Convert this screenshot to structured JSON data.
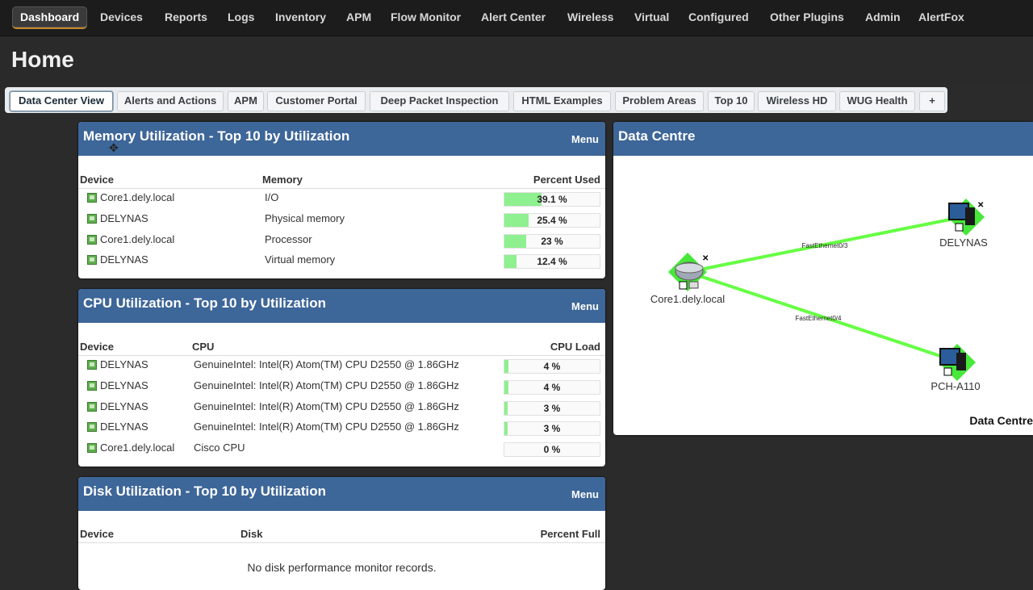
{
  "nav": [
    {
      "label": "Dashboard",
      "active": true
    },
    {
      "label": "Devices"
    },
    {
      "label": "Reports"
    },
    {
      "label": "Logs"
    },
    {
      "label": "Inventory"
    },
    {
      "label": "APM"
    },
    {
      "label": "Flow Monitor"
    },
    {
      "label": "Alert Center"
    },
    {
      "label": "Wireless"
    },
    {
      "label": "Virtual"
    },
    {
      "label": "Configured"
    },
    {
      "label": "Other Plugins"
    },
    {
      "label": "Admin"
    },
    {
      "label": "AlertFox"
    }
  ],
  "page": {
    "title": "Home"
  },
  "tabs": [
    {
      "label": "Data Center View",
      "active": true
    },
    {
      "label": "Alerts and Actions"
    },
    {
      "label": "APM"
    },
    {
      "label": "Customer Portal"
    },
    {
      "label": "Deep Packet Inspection"
    },
    {
      "label": "HTML Examples"
    },
    {
      "label": "Problem Areas"
    },
    {
      "label": "Top 10"
    },
    {
      "label": "Wireless HD"
    },
    {
      "label": "WUG Health"
    },
    {
      "label": "+"
    }
  ],
  "memory": {
    "title": "Memory Utilization - Top 10 by Utilization",
    "menu": "Menu",
    "columns": {
      "device": "Device",
      "metric": "Memory",
      "value": "Percent Used"
    },
    "rows": [
      {
        "device": "Core1.dely.local",
        "metric": "I/O",
        "pct": 39.1,
        "label": "39.1 %"
      },
      {
        "device": "DELYNAS",
        "metric": "Physical memory",
        "pct": 25.4,
        "label": "25.4 %"
      },
      {
        "device": "Core1.dely.local",
        "metric": "Processor",
        "pct": 23,
        "label": "23 %"
      },
      {
        "device": "DELYNAS",
        "metric": "Virtual memory",
        "pct": 12.4,
        "label": "12.4 %"
      }
    ]
  },
  "cpu": {
    "title": "CPU Utilization - Top 10 by Utilization",
    "menu": "Menu",
    "columns": {
      "device": "Device",
      "metric": "CPU",
      "value": "CPU Load"
    },
    "rows": [
      {
        "device": "DELYNAS",
        "metric": "GenuineIntel: Intel(R) Atom(TM) CPU D2550 @ 1.86GHz",
        "pct": 4,
        "label": "4 %"
      },
      {
        "device": "DELYNAS",
        "metric": "GenuineIntel: Intel(R) Atom(TM) CPU D2550 @ 1.86GHz",
        "pct": 4,
        "label": "4 %"
      },
      {
        "device": "DELYNAS",
        "metric": "GenuineIntel: Intel(R) Atom(TM) CPU D2550 @ 1.86GHz",
        "pct": 3,
        "label": "3 %"
      },
      {
        "device": "DELYNAS",
        "metric": "GenuineIntel: Intel(R) Atom(TM) CPU D2550 @ 1.86GHz",
        "pct": 3,
        "label": "3 %"
      },
      {
        "device": "Core1.dely.local",
        "metric": "Cisco CPU",
        "pct": 0,
        "label": "0 %"
      }
    ]
  },
  "disk": {
    "title": "Disk Utilization - Top 10 by Utilization",
    "menu": "Menu",
    "columns": {
      "device": "Device",
      "metric": "Disk",
      "value": "Percent Full"
    },
    "empty": "No disk performance monitor records."
  },
  "datacentre": {
    "title": "Data Centre",
    "caption": "Data Centre",
    "nodes": [
      {
        "id": "core",
        "name": "Core1.dely.local",
        "icon": "router-icon"
      },
      {
        "id": "nas",
        "name": "DELYNAS",
        "icon": "workstation-icon"
      },
      {
        "id": "pch",
        "name": "PCH-A110",
        "icon": "workstation-icon"
      }
    ],
    "links": [
      {
        "from": "core",
        "to": "nas",
        "label": "FastEthernet0/3"
      },
      {
        "from": "core",
        "to": "pch",
        "label": "FastEthernet0/4"
      }
    ],
    "link_color": "#66ff44"
  }
}
